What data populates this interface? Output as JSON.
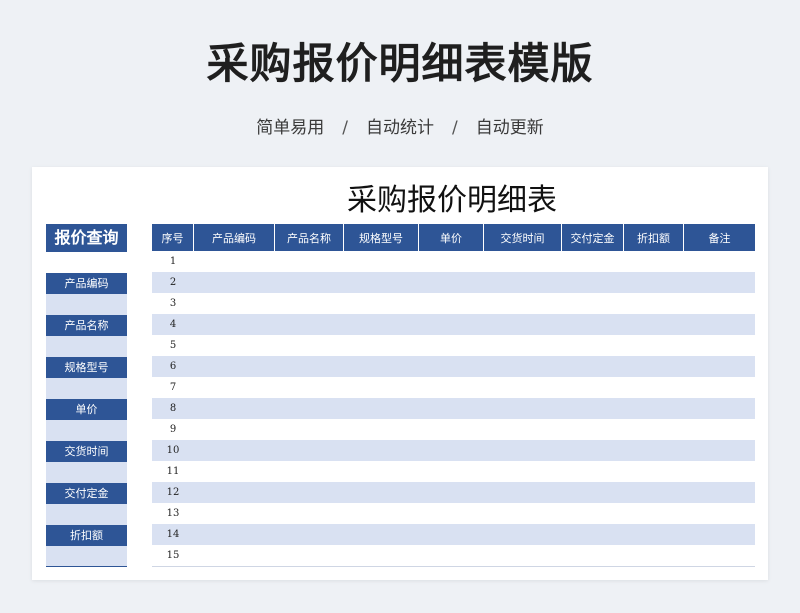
{
  "header": {
    "title": "采购报价明细表模版",
    "subtitle_parts": [
      "简单易用",
      "自动统计",
      "自动更新"
    ],
    "separator": "/"
  },
  "sheet": {
    "title": "采购报价明细表"
  },
  "query_panel": {
    "title": "报价查询",
    "fields": [
      "产品编码",
      "产品名称",
      "规格型号",
      "单价",
      "交货时间",
      "交付定金",
      "折扣额"
    ]
  },
  "table": {
    "columns": [
      "序号",
      "产品编码",
      "产品名称",
      "规格型号",
      "单价",
      "交货时间",
      "交付定金",
      "折扣额",
      "备注"
    ],
    "rows": [
      "1",
      "2",
      "3",
      "4",
      "5",
      "6",
      "7",
      "8",
      "9",
      "10",
      "11",
      "12",
      "13",
      "14",
      "15"
    ]
  },
  "colors": {
    "accent": "#2e5596",
    "row_alt": "#d9e1f2",
    "background": "#eef1f5"
  }
}
